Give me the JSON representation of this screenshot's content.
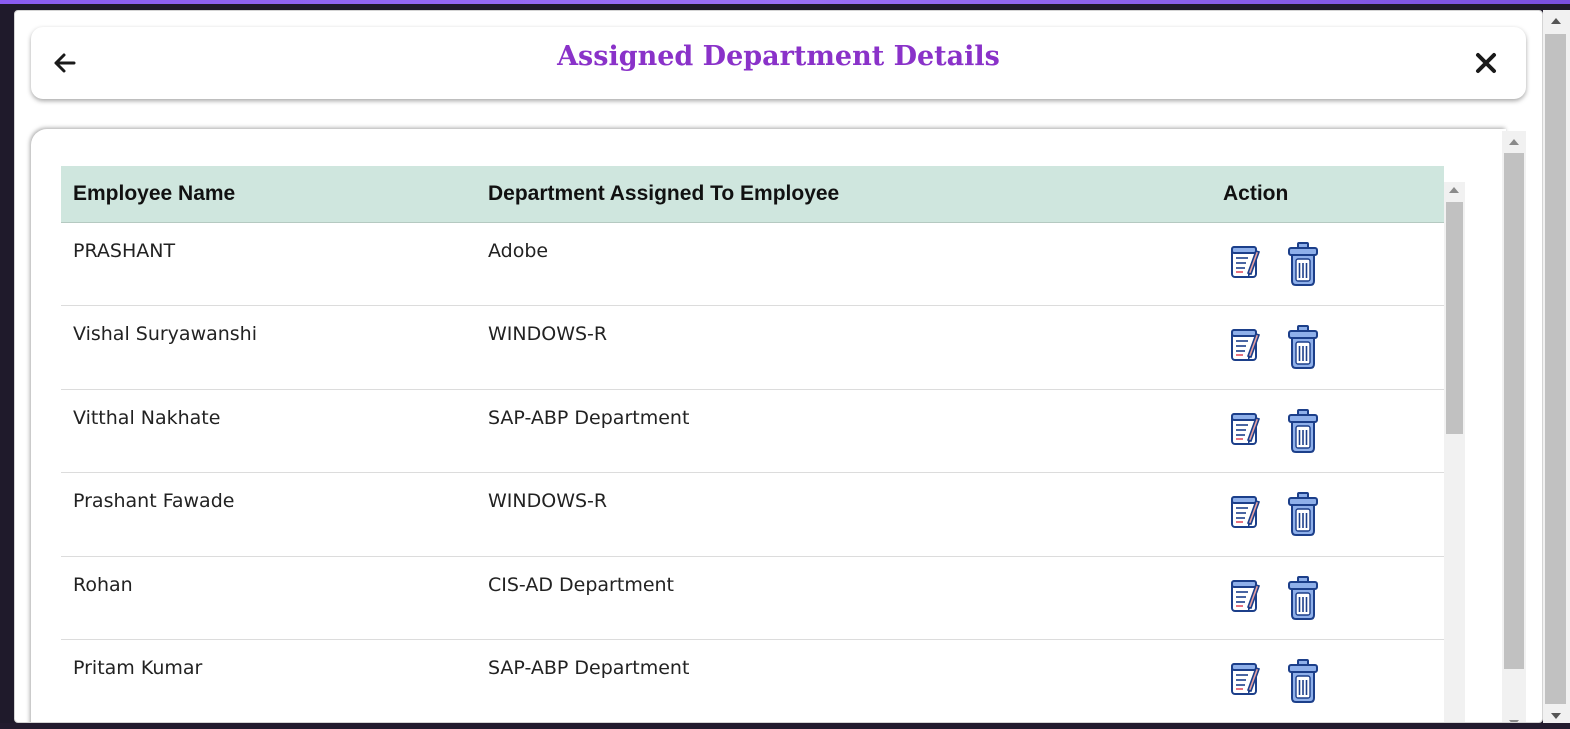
{
  "header": {
    "title": "Assigned Department Details",
    "back_icon": "arrow-left-icon",
    "close_icon": "close-icon"
  },
  "colors": {
    "title": "#8a32c9",
    "table_header_bg": "#cfe6de",
    "icon_blue": "#1c3f8a",
    "icon_fill": "#8fb0ea"
  },
  "table": {
    "columns": [
      "Employee Name",
      "Department Assigned To Employee",
      "Action"
    ],
    "rows": [
      {
        "name": "PRASHANT",
        "department": "Adobe"
      },
      {
        "name": "Vishal Suryawanshi",
        "department": "WINDOWS-R"
      },
      {
        "name": "Vitthal Nakhate",
        "department": "SAP-ABP Department"
      },
      {
        "name": "Prashant Fawade",
        "department": "WINDOWS-R"
      },
      {
        "name": "Rohan",
        "department": "CIS-AD Department"
      },
      {
        "name": "Pritam Kumar",
        "department": "SAP-ABP Department"
      }
    ],
    "row_actions": [
      "edit-icon",
      "trash-icon"
    ]
  }
}
